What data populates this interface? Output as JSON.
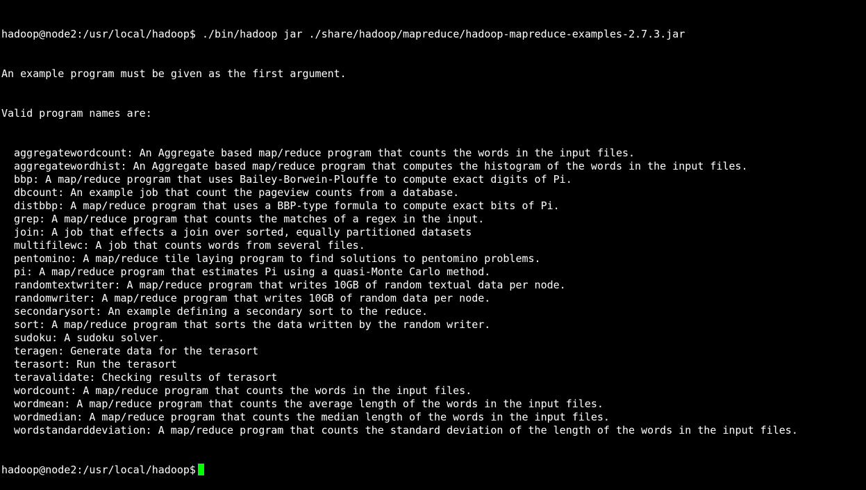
{
  "terminal": {
    "command_line": "hadoop@node2:/usr/local/hadoop$ ./bin/hadoop jar ./share/hadoop/mapreduce/hadoop-mapreduce-examples-2.7.3.jar",
    "message1": "An example program must be given as the first argument.",
    "message2": "Valid program names are:",
    "programs": [
      "aggregatewordcount: An Aggregate based map/reduce program that counts the words in the input files.",
      "aggregatewordhist: An Aggregate based map/reduce program that computes the histogram of the words in the input files.",
      "bbp: A map/reduce program that uses Bailey-Borwein-Plouffe to compute exact digits of Pi.",
      "dbcount: An example job that count the pageview counts from a database.",
      "distbbp: A map/reduce program that uses a BBP-type formula to compute exact bits of Pi.",
      "grep: A map/reduce program that counts the matches of a regex in the input.",
      "join: A job that effects a join over sorted, equally partitioned datasets",
      "multifilewc: A job that counts words from several files.",
      "pentomino: A map/reduce tile laying program to find solutions to pentomino problems.",
      "pi: A map/reduce program that estimates Pi using a quasi-Monte Carlo method.",
      "randomtextwriter: A map/reduce program that writes 10GB of random textual data per node.",
      "randomwriter: A map/reduce program that writes 10GB of random data per node.",
      "secondarysort: An example defining a secondary sort to the reduce.",
      "sort: A map/reduce program that sorts the data written by the random writer.",
      "sudoku: A sudoku solver.",
      "teragen: Generate data for the terasort",
      "terasort: Run the terasort",
      "teravalidate: Checking results of terasort",
      "wordcount: A map/reduce program that counts the words in the input files.",
      "wordmean: A map/reduce program that counts the average length of the words in the input files.",
      "wordmedian: A map/reduce program that counts the median length of the words in the input files.",
      "wordstandarddeviation: A map/reduce program that counts the standard deviation of the length of the words in the input files."
    ],
    "prompt": "hadoop@node2:/usr/local/hadoop$",
    "colors": {
      "background": "#000000",
      "text": "#ffffff",
      "cursor": "#00ff00"
    }
  }
}
